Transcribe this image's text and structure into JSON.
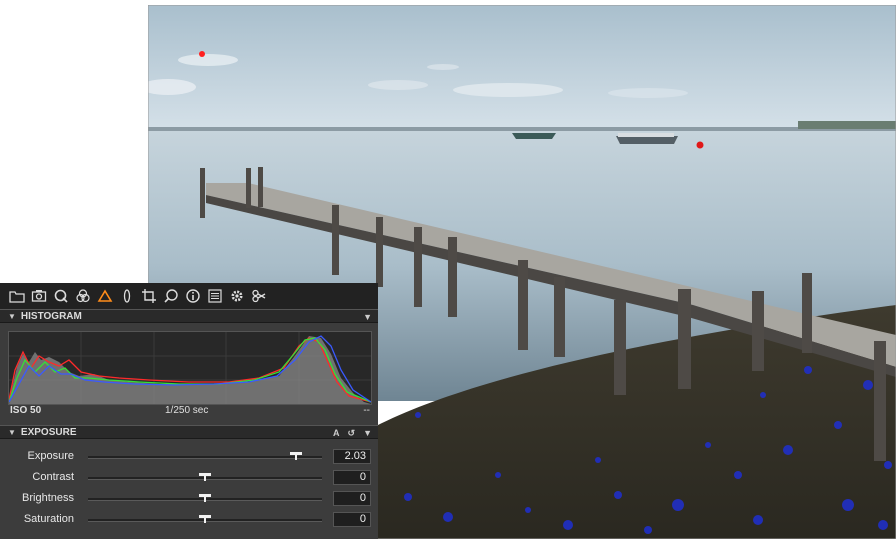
{
  "toolbar": {
    "icons": [
      "folder-icon",
      "camera-icon",
      "search-q-icon",
      "color-icon",
      "exposure-icon",
      "lens-icon",
      "crop-icon",
      "loupe-icon",
      "info-icon",
      "list-icon",
      "gear-icon",
      "scissors-icon"
    ],
    "active": "exposure-icon",
    "accent_color": "#ff8c1a"
  },
  "histogram": {
    "title": "HISTOGRAM",
    "iso": "ISO 50",
    "shutter": "1/250 sec",
    "aperture": "--"
  },
  "exposure": {
    "title": "EXPOSURE",
    "auto_label": "A",
    "rows": [
      {
        "label": "Exposure",
        "value": "2.03",
        "position": 0.89
      },
      {
        "label": "Contrast",
        "value": "0",
        "position": 0.5
      },
      {
        "label": "Brightness",
        "value": "0",
        "position": 0.5
      },
      {
        "label": "Saturation",
        "value": "0",
        "position": 0.5
      }
    ]
  }
}
